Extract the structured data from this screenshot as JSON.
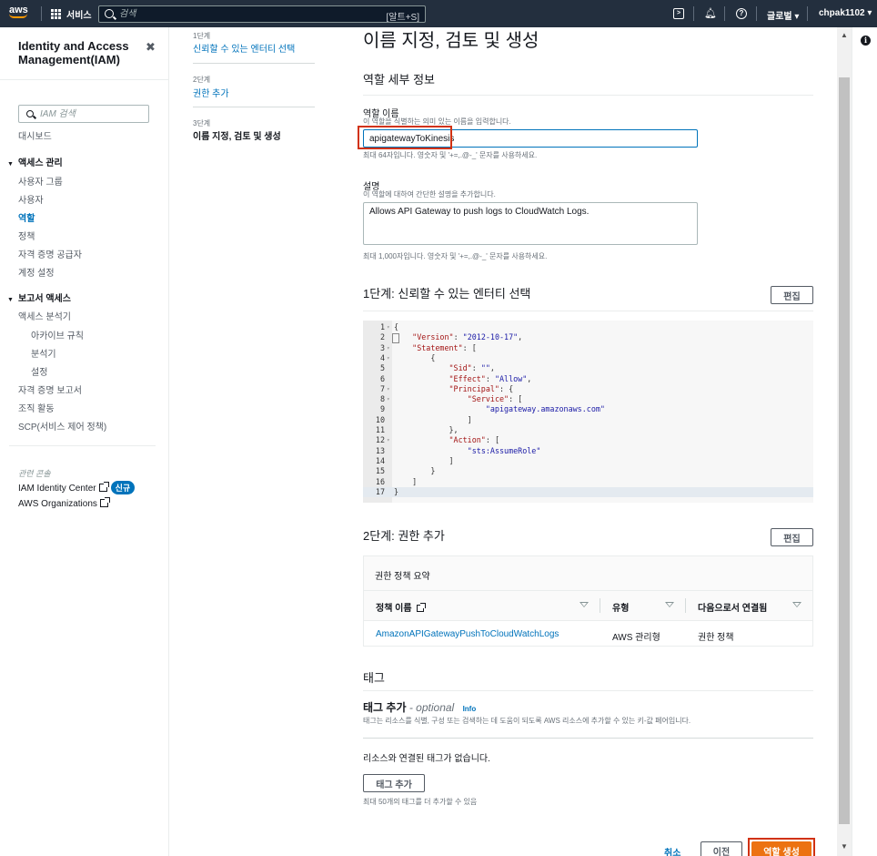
{
  "topnav": {
    "logo": "aws",
    "services": "서비스",
    "search_placeholder": "검색",
    "search_shortcut": "[알트+S]",
    "region": "글로벌 ▾",
    "account": "chpak1102 ▾",
    "bg_color": "#232f3e"
  },
  "sidebar": {
    "title": "Identity and Access Management(IAM)",
    "search_placeholder": "IAM 검색",
    "dashboard": "대시보드",
    "access_mgmt": "액세스 관리",
    "access_items": [
      "사용자 그룹",
      "사용자",
      "역할",
      "정책",
      "자격 증명 공급자",
      "계정 설정"
    ],
    "active_item": "역할",
    "reports": "보고서 액세스",
    "report_items": [
      "액세스 분석기",
      "아카이브 규칙",
      "분석기",
      "설정",
      "자격 증명 보고서",
      "조직 활동",
      "SCP(서비스 제어 정책)"
    ],
    "related": "관련 콘솔",
    "identity_center": "IAM Identity Center",
    "new_badge": "신규",
    "organizations": "AWS Organizations"
  },
  "steps": [
    {
      "label": "1단계",
      "name": "신뢰할 수 있는 엔터티 선택"
    },
    {
      "label": "2단계",
      "name": "권한 추가"
    },
    {
      "label": "3단계",
      "name": "이름 지정, 검토 및 생성"
    }
  ],
  "main": {
    "title": "이름 지정, 검토 및 생성",
    "role_details": "역할 세부 정보",
    "role_name_label": "역할 이름",
    "role_name_desc": "이 역할을 식별하는 의미 있는 이름을 입력합니다.",
    "role_name_value": "apigatewayToKinesis",
    "role_name_hint": "최대 64자입니다. 영숫자 및 '+=,.@-_' 문자를 사용하세요.",
    "desc_label": "설명",
    "desc_desc": "이 역할에 대하여 간단한 설명을 추가합니다.",
    "desc_value": "Allows API Gateway to push logs to CloudWatch Logs.",
    "desc_hint": "최대 1,000자입니다. 영숫자 및 '+=,.@-_' 문자를 사용하세요.",
    "step1_title": "1단계: 신뢰할 수 있는 엔터티 선택",
    "edit": "편집",
    "step2_title": "2단계: 권한 추가",
    "perm_summary": "권한 정책 요약",
    "col_policy": "정책 이름",
    "col_type": "유형",
    "col_attached": "다음으로서 연결됨",
    "row_policy": "AmazonAPIGatewayPushToCloudWatchLogs",
    "row_type": "AWS 관리형",
    "row_attached": "권한 정책",
    "tags_title": "태그",
    "add_tags": "태그 추가",
    "optional": "- optional",
    "info": "Info",
    "tags_desc": "태그는 리소스를 식별, 구성 또는 검색하는 데 도움이 되도록 AWS 리소스에 추가할 수 있는 키-값 페어입니다.",
    "no_tags": "리소스와 연결된 태그가 없습니다.",
    "add_tag_btn": "태그 추가",
    "tag_limit": "최대 50개의 태그를 더 추가할 수 있음",
    "cancel": "취소",
    "previous": "이전",
    "create": "역할 생성",
    "accent_color": "#ec7211",
    "highlight_color": "#d13212"
  },
  "code_lines": [
    {
      "n": "1",
      "fold": "▾",
      "t": "{"
    },
    {
      "n": "2",
      "fold": "",
      "t": "    \"Version\": \"2012-10-17\","
    },
    {
      "n": "3",
      "fold": "▾",
      "t": "    \"Statement\": ["
    },
    {
      "n": "4",
      "fold": "▾",
      "t": "        {"
    },
    {
      "n": "5",
      "fold": "",
      "t": "            \"Sid\": \"\","
    },
    {
      "n": "6",
      "fold": "",
      "t": "            \"Effect\": \"Allow\","
    },
    {
      "n": "7",
      "fold": "▾",
      "t": "            \"Principal\": {"
    },
    {
      "n": "8",
      "fold": "▾",
      "t": "                \"Service\": ["
    },
    {
      "n": "9",
      "fold": "",
      "t": "                    \"apigateway.amazonaws.com\""
    },
    {
      "n": "10",
      "fold": "",
      "t": "                ]"
    },
    {
      "n": "11",
      "fold": "",
      "t": "            },"
    },
    {
      "n": "12",
      "fold": "▾",
      "t": "            \"Action\": ["
    },
    {
      "n": "13",
      "fold": "",
      "t": "                \"sts:AssumeRole\""
    },
    {
      "n": "14",
      "fold": "",
      "t": "            ]"
    },
    {
      "n": "15",
      "fold": "",
      "t": "        }"
    },
    {
      "n": "16",
      "fold": "",
      "t": "    ]"
    },
    {
      "n": "17",
      "fold": "",
      "t": "}"
    }
  ]
}
